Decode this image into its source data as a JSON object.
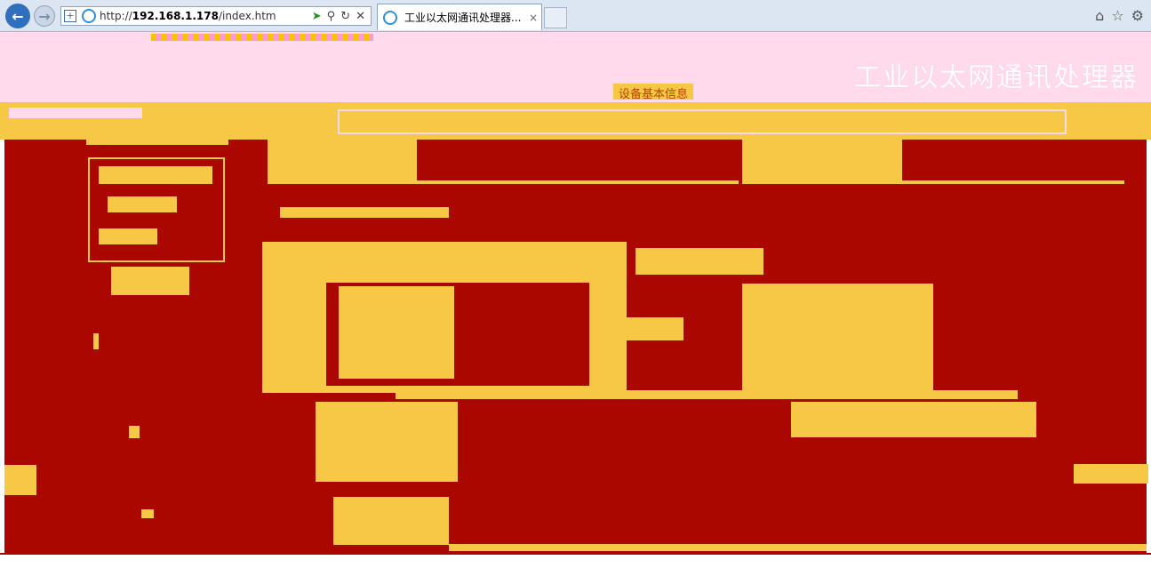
{
  "browser": {
    "url_prefix": "http://",
    "url_host": "192.168.1.178",
    "url_path": "/index.htm",
    "tab_title": "工业以太网通讯处理器...",
    "tab_close": "×",
    "back_icon": "back-arrow-icon",
    "forward_icon": "forward-arrow-icon"
  },
  "header": {
    "site_title": "工业以太网通讯处理器",
    "tagline": "设备基本信息"
  },
  "colors": {
    "primary": "#a90700",
    "accent": "#f7c845",
    "header_bg": "#ffd9ec"
  }
}
